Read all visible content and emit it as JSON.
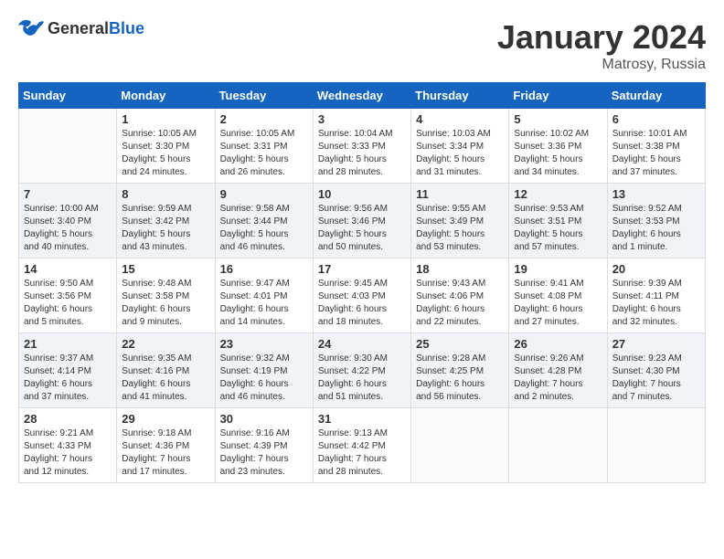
{
  "header": {
    "logo_general": "General",
    "logo_blue": "Blue",
    "month_title": "January 2024",
    "location": "Matrosy, Russia"
  },
  "weekdays": [
    "Sunday",
    "Monday",
    "Tuesday",
    "Wednesday",
    "Thursday",
    "Friday",
    "Saturday"
  ],
  "weeks": [
    [
      {
        "day": "",
        "info": ""
      },
      {
        "day": "1",
        "info": "Sunrise: 10:05 AM\nSunset: 3:30 PM\nDaylight: 5 hours\nand 24 minutes."
      },
      {
        "day": "2",
        "info": "Sunrise: 10:05 AM\nSunset: 3:31 PM\nDaylight: 5 hours\nand 26 minutes."
      },
      {
        "day": "3",
        "info": "Sunrise: 10:04 AM\nSunset: 3:33 PM\nDaylight: 5 hours\nand 28 minutes."
      },
      {
        "day": "4",
        "info": "Sunrise: 10:03 AM\nSunset: 3:34 PM\nDaylight: 5 hours\nand 31 minutes."
      },
      {
        "day": "5",
        "info": "Sunrise: 10:02 AM\nSunset: 3:36 PM\nDaylight: 5 hours\nand 34 minutes."
      },
      {
        "day": "6",
        "info": "Sunrise: 10:01 AM\nSunset: 3:38 PM\nDaylight: 5 hours\nand 37 minutes."
      }
    ],
    [
      {
        "day": "7",
        "info": "Sunrise: 10:00 AM\nSunset: 3:40 PM\nDaylight: 5 hours\nand 40 minutes."
      },
      {
        "day": "8",
        "info": "Sunrise: 9:59 AM\nSunset: 3:42 PM\nDaylight: 5 hours\nand 43 minutes."
      },
      {
        "day": "9",
        "info": "Sunrise: 9:58 AM\nSunset: 3:44 PM\nDaylight: 5 hours\nand 46 minutes."
      },
      {
        "day": "10",
        "info": "Sunrise: 9:56 AM\nSunset: 3:46 PM\nDaylight: 5 hours\nand 50 minutes."
      },
      {
        "day": "11",
        "info": "Sunrise: 9:55 AM\nSunset: 3:49 PM\nDaylight: 5 hours\nand 53 minutes."
      },
      {
        "day": "12",
        "info": "Sunrise: 9:53 AM\nSunset: 3:51 PM\nDaylight: 5 hours\nand 57 minutes."
      },
      {
        "day": "13",
        "info": "Sunrise: 9:52 AM\nSunset: 3:53 PM\nDaylight: 6 hours\nand 1 minute."
      }
    ],
    [
      {
        "day": "14",
        "info": "Sunrise: 9:50 AM\nSunset: 3:56 PM\nDaylight: 6 hours\nand 5 minutes."
      },
      {
        "day": "15",
        "info": "Sunrise: 9:48 AM\nSunset: 3:58 PM\nDaylight: 6 hours\nand 9 minutes."
      },
      {
        "day": "16",
        "info": "Sunrise: 9:47 AM\nSunset: 4:01 PM\nDaylight: 6 hours\nand 14 minutes."
      },
      {
        "day": "17",
        "info": "Sunrise: 9:45 AM\nSunset: 4:03 PM\nDaylight: 6 hours\nand 18 minutes."
      },
      {
        "day": "18",
        "info": "Sunrise: 9:43 AM\nSunset: 4:06 PM\nDaylight: 6 hours\nand 22 minutes."
      },
      {
        "day": "19",
        "info": "Sunrise: 9:41 AM\nSunset: 4:08 PM\nDaylight: 6 hours\nand 27 minutes."
      },
      {
        "day": "20",
        "info": "Sunrise: 9:39 AM\nSunset: 4:11 PM\nDaylight: 6 hours\nand 32 minutes."
      }
    ],
    [
      {
        "day": "21",
        "info": "Sunrise: 9:37 AM\nSunset: 4:14 PM\nDaylight: 6 hours\nand 37 minutes."
      },
      {
        "day": "22",
        "info": "Sunrise: 9:35 AM\nSunset: 4:16 PM\nDaylight: 6 hours\nand 41 minutes."
      },
      {
        "day": "23",
        "info": "Sunrise: 9:32 AM\nSunset: 4:19 PM\nDaylight: 6 hours\nand 46 minutes."
      },
      {
        "day": "24",
        "info": "Sunrise: 9:30 AM\nSunset: 4:22 PM\nDaylight: 6 hours\nand 51 minutes."
      },
      {
        "day": "25",
        "info": "Sunrise: 9:28 AM\nSunset: 4:25 PM\nDaylight: 6 hours\nand 56 minutes."
      },
      {
        "day": "26",
        "info": "Sunrise: 9:26 AM\nSunset: 4:28 PM\nDaylight: 7 hours\nand 2 minutes."
      },
      {
        "day": "27",
        "info": "Sunrise: 9:23 AM\nSunset: 4:30 PM\nDaylight: 7 hours\nand 7 minutes."
      }
    ],
    [
      {
        "day": "28",
        "info": "Sunrise: 9:21 AM\nSunset: 4:33 PM\nDaylight: 7 hours\nand 12 minutes."
      },
      {
        "day": "29",
        "info": "Sunrise: 9:18 AM\nSunset: 4:36 PM\nDaylight: 7 hours\nand 17 minutes."
      },
      {
        "day": "30",
        "info": "Sunrise: 9:16 AM\nSunset: 4:39 PM\nDaylight: 7 hours\nand 23 minutes."
      },
      {
        "day": "31",
        "info": "Sunrise: 9:13 AM\nSunset: 4:42 PM\nDaylight: 7 hours\nand 28 minutes."
      },
      {
        "day": "",
        "info": ""
      },
      {
        "day": "",
        "info": ""
      },
      {
        "day": "",
        "info": ""
      }
    ]
  ]
}
